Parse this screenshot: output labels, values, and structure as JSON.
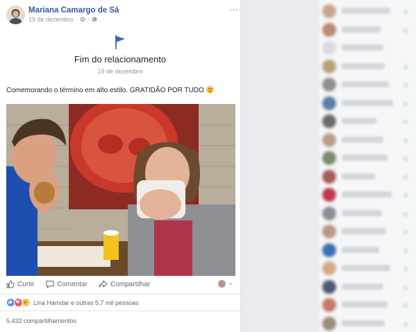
{
  "post": {
    "author": "Mariana Camargo de Sá",
    "date": "19 de dezembro",
    "more_label": "···",
    "event_title": "Fim do relacionamento",
    "event_date": "19 de dezembro",
    "caption": "Comemorando o término em alto estilo. GRATIDÃO POR TUDO",
    "actions": {
      "like": "Curtir",
      "comment": "Comentar",
      "share": "Compartilhar"
    },
    "reactions_text": "Lina Hamdar e outras 5,7 mil pessoas",
    "shares_text": "5.432 compartilhamentos"
  },
  "sidebar": {
    "friends": [
      {
        "color": "#c9a58c"
      },
      {
        "color": "#b98a6e"
      },
      {
        "color": "#d9dbe0"
      },
      {
        "color": "#b8a079"
      },
      {
        "color": "#8f8f8f"
      },
      {
        "color": "#5c7da3"
      },
      {
        "color": "#6b6b6b"
      },
      {
        "color": "#b89e8c"
      },
      {
        "color": "#7a8a6b"
      },
      {
        "color": "#a85a5a"
      },
      {
        "color": "#c2364a"
      },
      {
        "color": "#8a8f99"
      },
      {
        "color": "#b59a86"
      },
      {
        "color": "#3b6fb6"
      },
      {
        "color": "#d2a98a"
      },
      {
        "color": "#4e5a70"
      },
      {
        "color": "#c47a6a"
      },
      {
        "color": "#9a8c7a"
      }
    ]
  },
  "colors": {
    "link": "#365899",
    "like_blue": "#5890ff",
    "love_red": "#f25268",
    "haha_yellow": "#f7c948"
  }
}
